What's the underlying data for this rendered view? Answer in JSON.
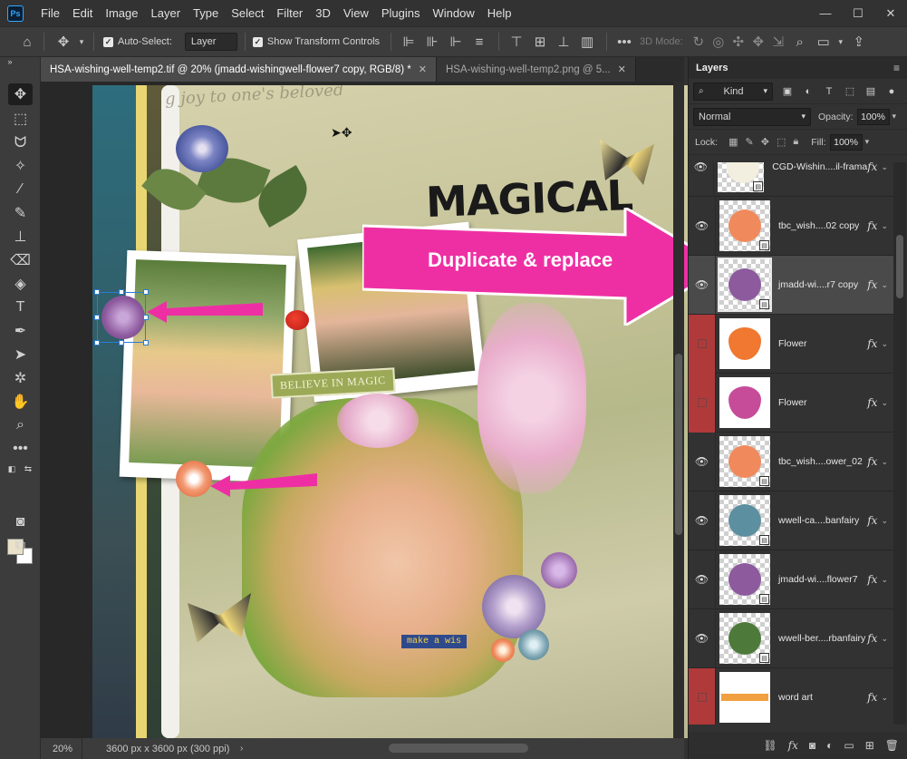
{
  "menu": [
    "File",
    "Edit",
    "Image",
    "Layer",
    "Type",
    "Select",
    "Filter",
    "3D",
    "View",
    "Plugins",
    "Window",
    "Help"
  ],
  "logo": "Ps",
  "options": {
    "auto_select_label": "Auto-Select:",
    "auto_select_value": "Layer",
    "show_transform_label": "Show Transform Controls",
    "mode_3d_label": "3D Mode:"
  },
  "tabs": [
    {
      "label": "HSA-wishing-well-temp2.tif @ 20% (jmadd-wishingwell-flower7 copy, RGB/8) *",
      "active": true
    },
    {
      "label": "HSA-wishing-well-temp2.png @ 5...",
      "active": false
    }
  ],
  "canvas": {
    "magical_text": "MAGICAL",
    "arrow_text": "Duplicate & replace",
    "believe_text": "BELIEVE IN MAGIC",
    "make_wish_text": "make a wis",
    "handwriting_text": "g joy to one's beloved"
  },
  "status": {
    "zoom": "20%",
    "doc_info": "3600 px x 3600 px (300 ppi)"
  },
  "layers_panel": {
    "title": "Layers",
    "filter_kind": "Kind",
    "blend_mode": "Normal",
    "opacity_label": "Opacity:",
    "opacity_value": "100%",
    "lock_label": "Lock:",
    "fill_label": "Fill:",
    "fill_value": "100%",
    "fx_label": "fx",
    "layers": [
      {
        "name": "CGD-Wishin....il-frama",
        "visible": true,
        "selected": false,
        "red": false,
        "color": "#f3efe0"
      },
      {
        "name": "tbc_wish....02 copy",
        "visible": true,
        "selected": false,
        "red": false,
        "color": "#f08a5d"
      },
      {
        "name": "jmadd-wi....r7 copy",
        "visible": true,
        "selected": true,
        "red": false,
        "color": "#8d5a9e"
      },
      {
        "name": "Flower",
        "visible": false,
        "selected": false,
        "red": true,
        "color": "#f07830"
      },
      {
        "name": "Flower",
        "visible": false,
        "selected": false,
        "red": true,
        "color": "#c64c9a"
      },
      {
        "name": "tbc_wish....ower_02",
        "visible": true,
        "selected": false,
        "red": false,
        "color": "#f08a5d"
      },
      {
        "name": "wwell-ca....banfairy",
        "visible": true,
        "selected": false,
        "red": false,
        "color": "#5c8fa0"
      },
      {
        "name": "jmadd-wi....flower7",
        "visible": true,
        "selected": false,
        "red": false,
        "color": "#8d5a9e"
      },
      {
        "name": "wwell-ber....rbanfairy",
        "visible": true,
        "selected": false,
        "red": false,
        "color": "#4d7a3a"
      },
      {
        "name": "word art",
        "visible": false,
        "selected": false,
        "red": true,
        "color": "#f0a040"
      }
    ]
  },
  "colors": {
    "accent_pink": "#ee2fa4",
    "selection_blue": "#2a7bd8",
    "layer_red": "#b03a3a"
  }
}
